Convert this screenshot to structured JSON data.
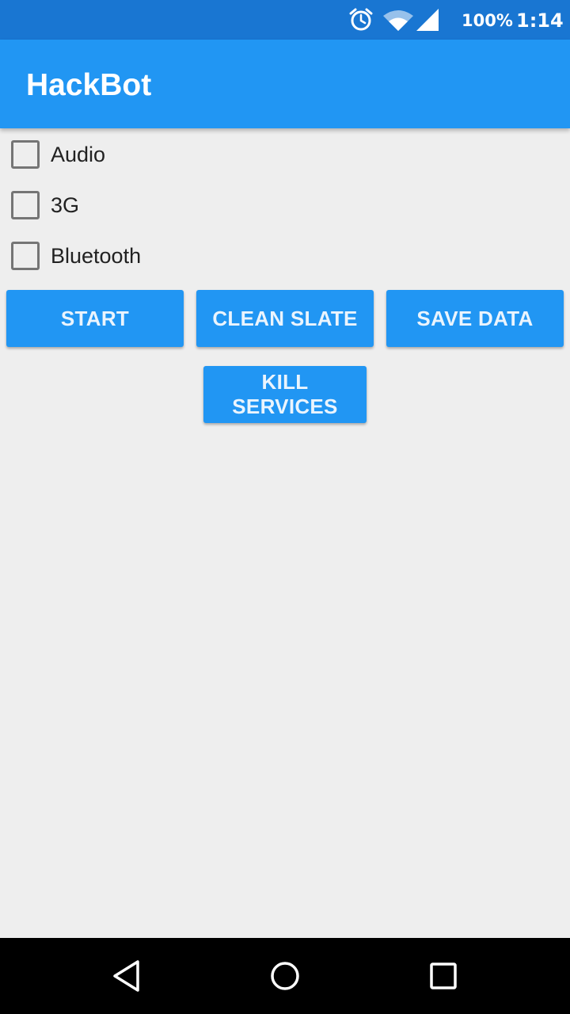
{
  "status_bar": {
    "icons": [
      "alarm-icon",
      "wifi-icon",
      "signal-icon"
    ],
    "battery": "100%",
    "time": "1:14"
  },
  "app_bar": {
    "title": "HackBot",
    "color": "#2196f3"
  },
  "options": [
    {
      "label": "Audio",
      "checked": false
    },
    {
      "label": "3G",
      "checked": false
    },
    {
      "label": "Bluetooth",
      "checked": false
    }
  ],
  "buttons": {
    "start": "START",
    "clean_slate": "CLEAN SLATE",
    "save_data": "SAVE DATA",
    "kill_services": "KILL SERVICES"
  },
  "nav_bar": {
    "icons": [
      "back-icon",
      "home-icon",
      "recents-icon"
    ]
  },
  "colors": {
    "accent": "#2196f3",
    "status_bar": "#1976d2",
    "background": "#eeeeee"
  }
}
